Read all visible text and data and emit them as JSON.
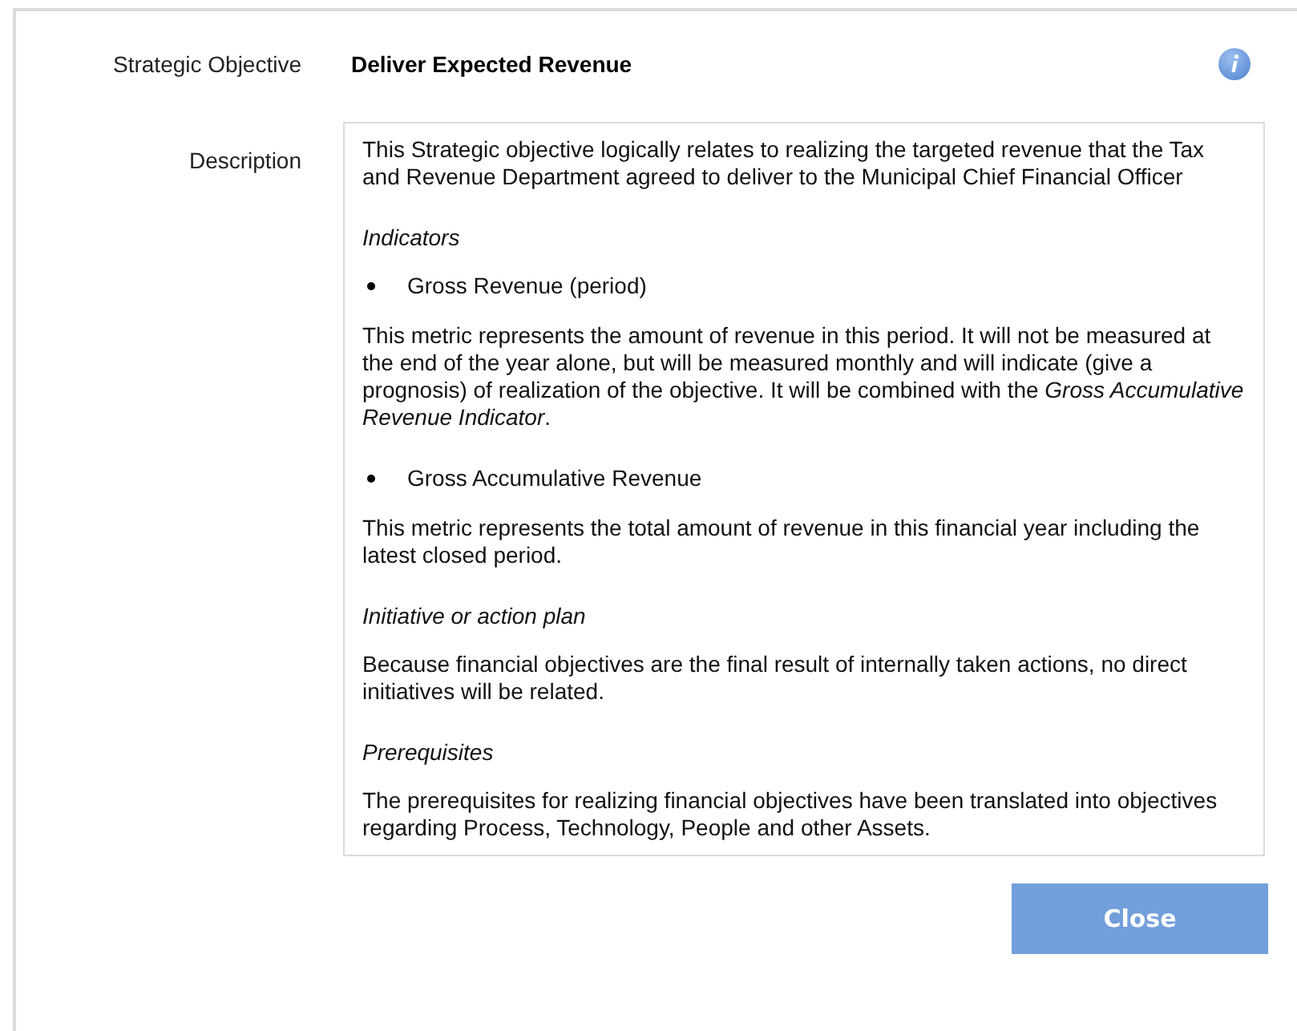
{
  "fields": [
    {
      "label": "Strategic Objective",
      "value": "Deliver Expected Revenue"
    }
  ],
  "description": {
    "label": "Description",
    "blocks": [
      {
        "kind": "paragraph",
        "text": "This Strategic objective logically relates to realizing the targeted revenue that the Tax and Revenue Department agreed to deliver to the Municipal Chief Financial Officer"
      },
      {
        "kind": "heading",
        "text": "Indicators"
      },
      {
        "kind": "bullet",
        "text": "Gross Revenue (period)"
      },
      {
        "kind": "paragraph",
        "text": "This metric represents the amount of revenue in this period. It will not be measured at the end of the year alone, but will be measured monthly and will indicate (give a prognosis) of realization of the objective. It will be combined with the *Gross Accumulative Revenue Indicator*."
      },
      {
        "kind": "bullet",
        "text": "Gross Accumulative Revenue"
      },
      {
        "kind": "paragraph",
        "text": "This metric represents the total amount of revenue in this financial year including the latest closed period."
      },
      {
        "kind": "heading",
        "text": "Initiative or action plan"
      },
      {
        "kind": "paragraph",
        "text": "Because financial objectives are the final result of internally taken actions, no direct initiatives will be related."
      },
      {
        "kind": "heading",
        "text": "Prerequisites"
      },
      {
        "kind": "paragraph",
        "text": "The prerequisites for realizing financial objectives have been translated into objectives regarding Process, Technology, People and other Assets."
      }
    ]
  },
  "buttons": [
    {
      "label": "Close"
    }
  ]
}
